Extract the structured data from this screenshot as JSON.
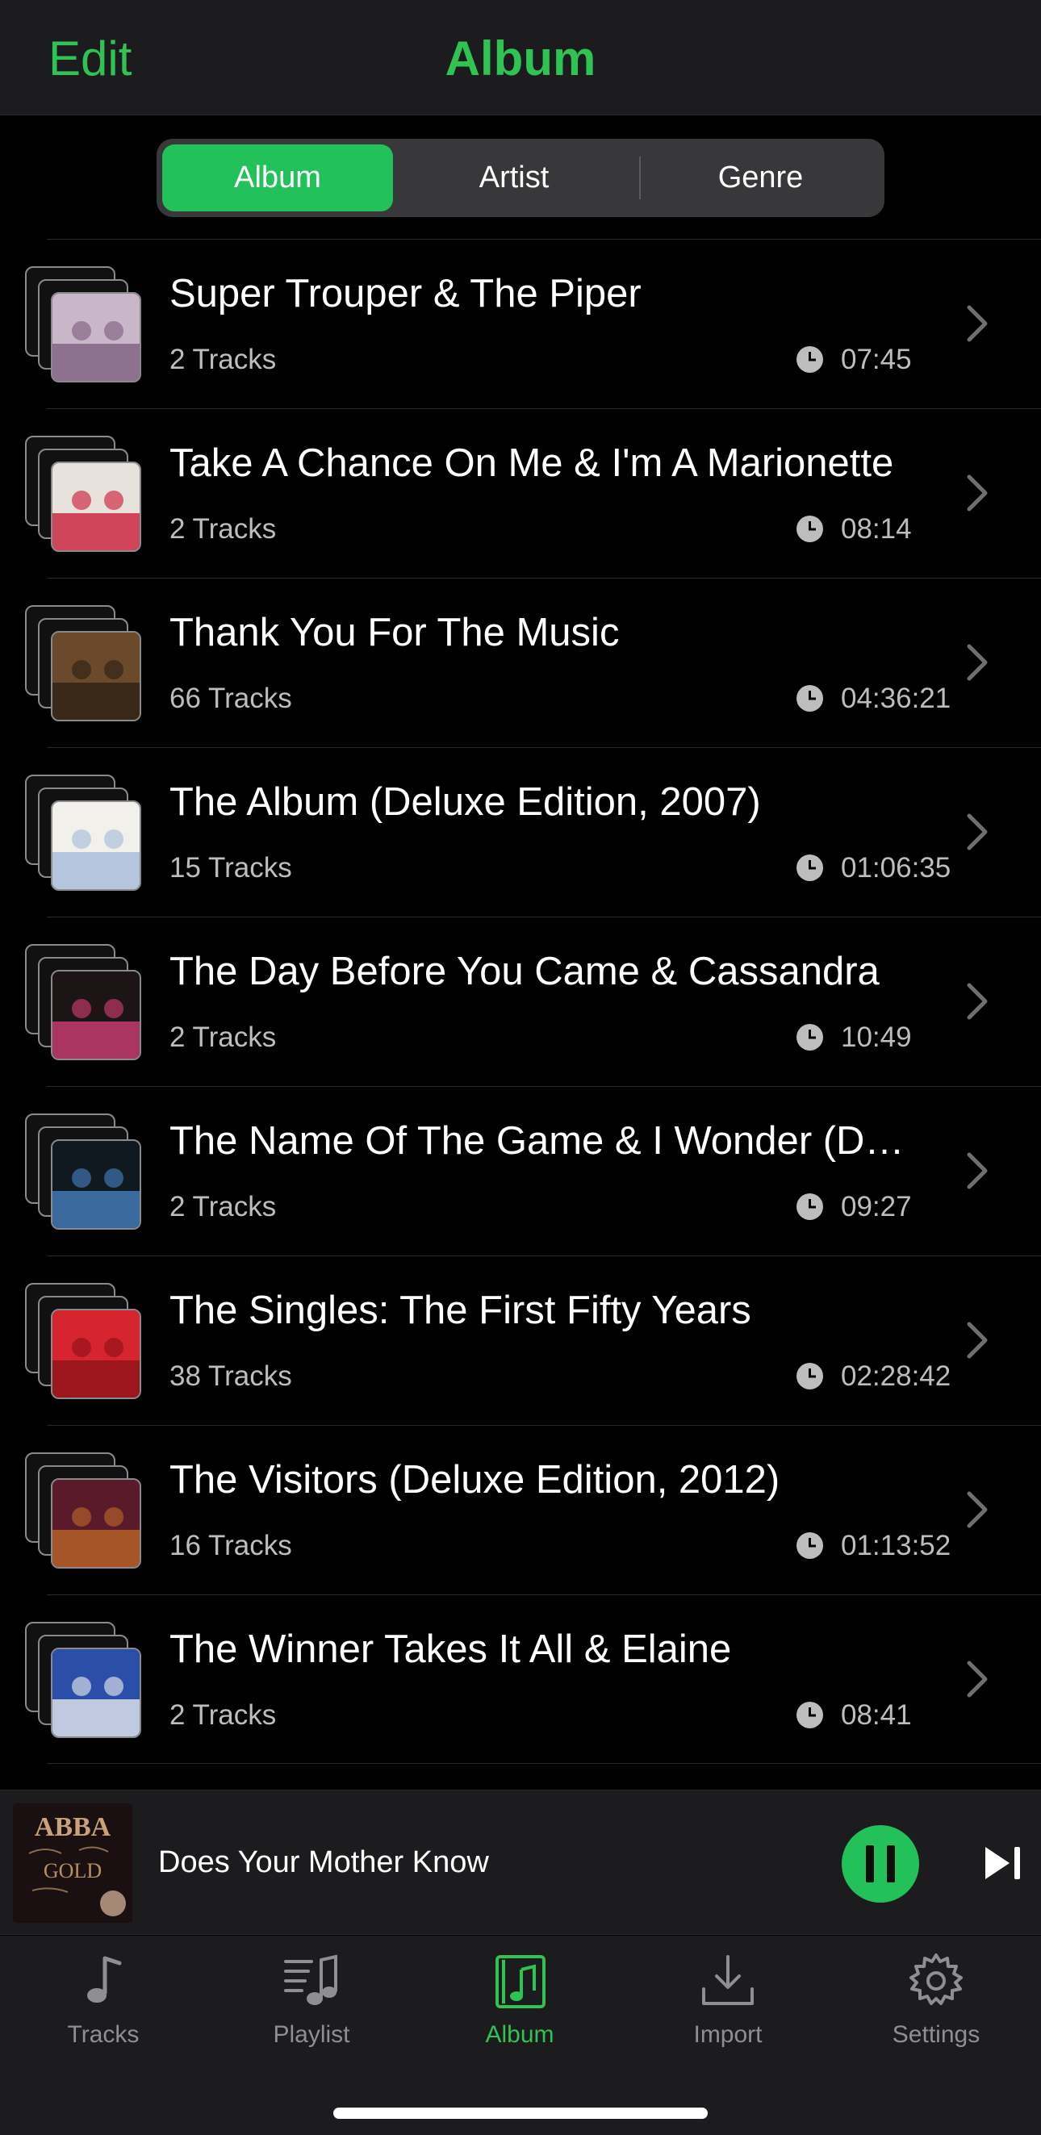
{
  "header": {
    "edit_label": "Edit",
    "title": "Album"
  },
  "segments": {
    "album": "Album",
    "artist": "Artist",
    "genre": "Genre",
    "selected": "Album"
  },
  "albums": [
    {
      "title": "Super Trouper & The Piper",
      "tracks": "2 Tracks",
      "duration": "07:45",
      "art_colors": [
        "#c9b7c9",
        "#7a5a7a"
      ]
    },
    {
      "title": "Take A Chance On Me & I'm A Marionette",
      "tracks": "2 Tracks",
      "duration": "08:14",
      "art_colors": [
        "#e8e2dc",
        "#c8102e"
      ]
    },
    {
      "title": "Thank You For The Music",
      "tracks": "66 Tracks",
      "duration": "04:36:21",
      "art_colors": [
        "#6b4a2c",
        "#2a1d12"
      ]
    },
    {
      "title": "The Album (Deluxe Edition, 2007)",
      "tracks": "15 Tracks",
      "duration": "01:06:35",
      "art_colors": [
        "#f2f0ea",
        "#9fb7d8"
      ]
    },
    {
      "title": "The Day Before You Came & Cassandra",
      "tracks": "2 Tracks",
      "duration": "10:49",
      "art_colors": [
        "#1d1416",
        "#d8407a"
      ]
    },
    {
      "title": "The Name Of The Game & I Wonder (Departure)",
      "tracks": "2 Tracks",
      "duration": "09:27",
      "art_colors": [
        "#101820",
        "#4a86c8"
      ]
    },
    {
      "title": "The Singles: The First Fifty Years",
      "tracks": "38 Tracks",
      "duration": "02:28:42",
      "art_colors": [
        "#d6252f",
        "#8a1018"
      ]
    },
    {
      "title": "The Visitors (Deluxe Edition, 2012)",
      "tracks": "16 Tracks",
      "duration": "01:13:52",
      "art_colors": [
        "#5a1a2a",
        "#c06a2a"
      ]
    },
    {
      "title": "The Winner Takes It All & Elaine",
      "tracks": "2 Tracks",
      "duration": "08:41",
      "art_colors": [
        "#2b4fa8",
        "#f1f1f1"
      ]
    }
  ],
  "now_playing": {
    "title": "Does Your Mother Know",
    "art_text": "ABBA",
    "art_subtext": "GOLD"
  },
  "tabs": [
    {
      "label": "Tracks",
      "icon": "music-note-icon",
      "active": false
    },
    {
      "label": "Playlist",
      "icon": "playlist-icon",
      "active": false
    },
    {
      "label": "Album",
      "icon": "album-icon",
      "active": true
    },
    {
      "label": "Import",
      "icon": "import-icon",
      "active": false
    },
    {
      "label": "Settings",
      "icon": "gear-icon",
      "active": false
    }
  ],
  "colors": {
    "accent": "#2fc354",
    "segment_active": "#22c15a",
    "background": "#000000",
    "bar": "#1c1c1e"
  }
}
